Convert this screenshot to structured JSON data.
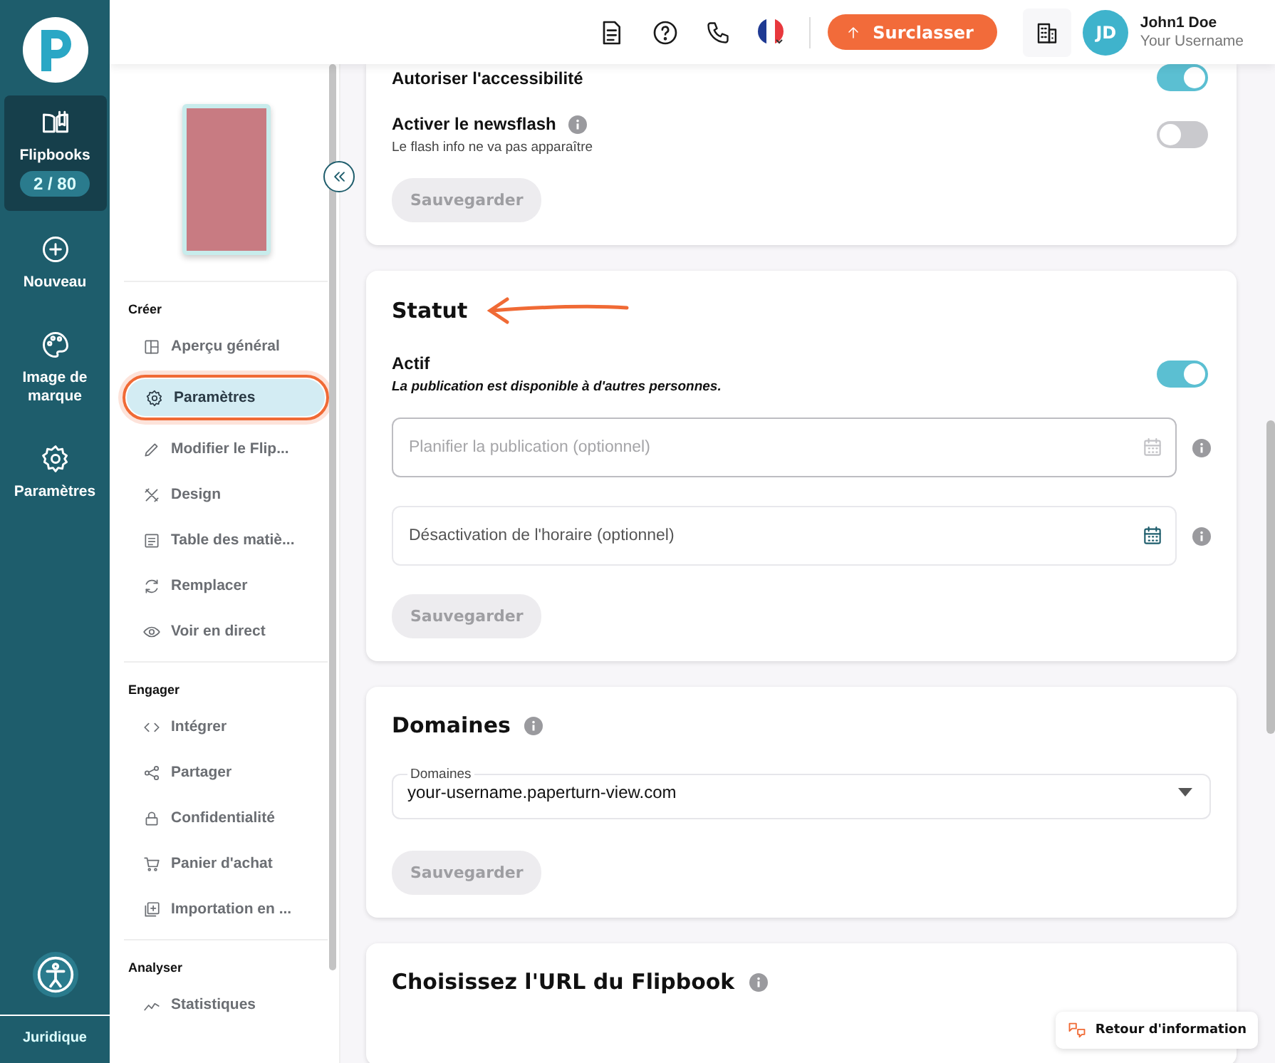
{
  "rail": {
    "items": [
      {
        "label": "Flipbooks",
        "badge": "2 / 80",
        "selected": true
      },
      {
        "label": "Nouveau",
        "selected": false
      },
      {
        "label": "Image de marque",
        "selected": false
      },
      {
        "label": "Paramètres",
        "selected": false
      }
    ],
    "footer": "Juridique"
  },
  "header": {
    "upgrade": "Surclasser",
    "user": {
      "initials": "JD",
      "name": "John1 Doe",
      "username": "Your Username"
    }
  },
  "sidebar": {
    "sections": [
      {
        "title": "Créer",
        "items": [
          {
            "label": "Aperçu général",
            "selected": false,
            "annotated": false
          },
          {
            "label": "Paramètres",
            "selected": true,
            "annotated": true
          },
          {
            "label": "Modifier le Flip...",
            "selected": false,
            "annotated": false
          },
          {
            "label": "Design",
            "selected": false,
            "annotated": false
          },
          {
            "label": "Table des matiè...",
            "selected": false,
            "annotated": false
          },
          {
            "label": "Remplacer",
            "selected": false,
            "annotated": false
          },
          {
            "label": "Voir en direct",
            "selected": false,
            "annotated": false
          }
        ]
      },
      {
        "title": "Engager",
        "items": [
          {
            "label": "Intégrer",
            "selected": false,
            "annotated": false
          },
          {
            "label": "Partager",
            "selected": false,
            "annotated": false
          },
          {
            "label": "Confidentialité",
            "selected": false,
            "annotated": false
          },
          {
            "label": "Panier d'achat",
            "selected": false,
            "annotated": false
          },
          {
            "label": "Importation en ...",
            "selected": false,
            "annotated": false
          }
        ]
      },
      {
        "title": "Analyser",
        "items": [
          {
            "label": "Statistiques",
            "selected": false,
            "annotated": false
          }
        ]
      }
    ]
  },
  "cards": [
    {
      "rows": [
        {
          "kind": "toggle",
          "label": "Autoriser l'accessibilité",
          "on": true
        },
        {
          "kind": "toggle",
          "label": "Activer le newsflash",
          "info": true,
          "hint": "Le flash info ne va pas apparaître",
          "hint_emphasis": false,
          "on": false
        }
      ],
      "button": {
        "label": "Sauvegarder",
        "disabled": true
      }
    },
    {
      "title": "Statut",
      "annotated": true,
      "rows": [
        {
          "kind": "toggle",
          "label": "Actif",
          "hint": "La publication est disponible à d'autres personnes.",
          "hint_emphasis": true,
          "on": true
        },
        {
          "kind": "date",
          "placeholder": "Planifier la publication (optionnel)",
          "disabled": true
        },
        {
          "kind": "date",
          "placeholder": "Désactivation de l'horaire (optionnel)",
          "disabled": false
        }
      ],
      "button": {
        "label": "Sauvegarder",
        "disabled": true
      }
    },
    {
      "title": "Domaines",
      "info": true,
      "rows": [
        {
          "kind": "select",
          "label": "Domaines",
          "value": "your-username.paperturn-view.com"
        }
      ],
      "button": {
        "label": "Sauvegarder",
        "disabled": true
      }
    },
    {
      "title": "Choisissez l'URL du Flipbook",
      "info": true
    }
  ],
  "feedback": "Retour d'information"
}
